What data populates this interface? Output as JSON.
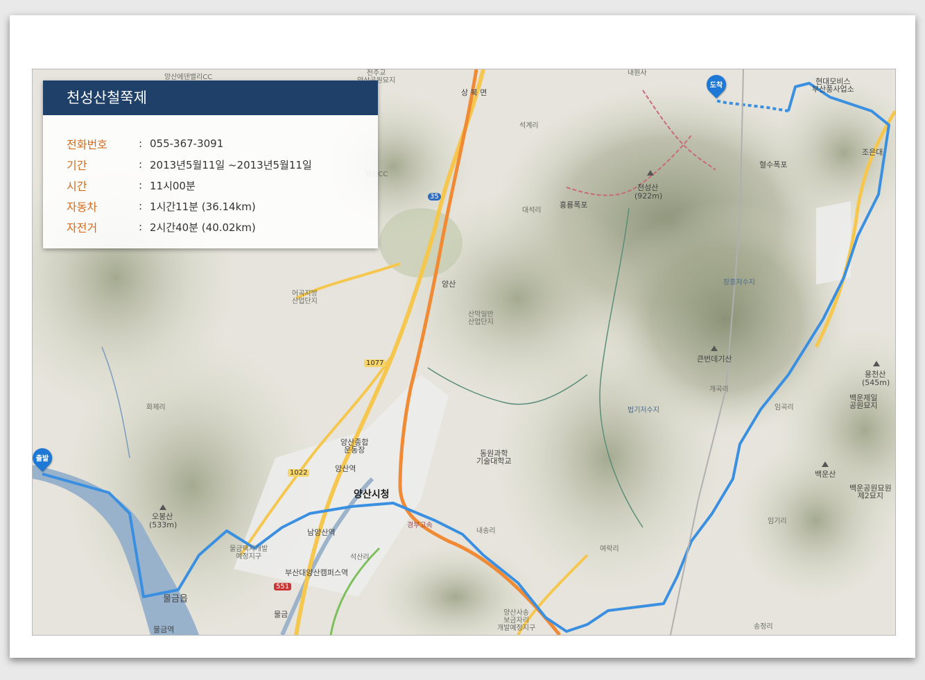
{
  "panel": {
    "title": "천성산철쭉제",
    "rows": [
      {
        "label": "전화번호",
        "value": "055-367-3091"
      },
      {
        "label": "기간",
        "value": "2013년5월11일 ~2013년5월11일"
      },
      {
        "label": "시간",
        "value": "11시00분"
      },
      {
        "label": "자동차",
        "value": "1시간11분 (36.14km)"
      },
      {
        "label": "자전거",
        "value": "2시간40분 (40.02km)"
      }
    ],
    "separator": ":"
  },
  "markers": {
    "start": "출발",
    "end": "도착"
  },
  "labels": {
    "city_hall": "양산시청",
    "cheonseongsan": "천성산",
    "cheonseongsan_h": "(922m)",
    "obongsan": "오봉산",
    "obongsan_h": "(533m)",
    "yongcheonsan": "용천산",
    "yongcheonsan_h": "(545m)",
    "baegunsan": "백운산",
    "keunbeondegisan": "큰번데기산",
    "heungnyong": "홍룡폭포",
    "hyeolsu": "혈수폭포",
    "yangsan_station": "양산역",
    "namyangsan_station": "남양산역",
    "pnu_station": "부산대양산캠퍼스역",
    "mulgeum_station": "물금역",
    "mulgeum_eup": "물금읍",
    "sports": "양산종합\n운동장",
    "dongwon": "동원과학\n기술대학교",
    "sanmak": "산막일반\n산업단지",
    "eogok": "어곡지방\n산업단지",
    "sangbuk": "상 북 면",
    "seokgye": "석계리",
    "daeseok": "대석리",
    "hwaje": "화제리",
    "naesong": "내송리",
    "yeorak": "여락리",
    "imgi": "임기리",
    "gaegok": "개곡리",
    "imgok": "임곡리",
    "songjeong": "송정리",
    "seoksan": "석산리",
    "beopgi": "법기저수지",
    "janghyeung": "장흥저수지",
    "hyundai": "현대모비스\n부산풍사업소",
    "baegun_cemetery": "백운공원묘원\n제2묘지",
    "baegun_jeil": "백운제일\n공원묘지",
    "gyeongbu": "경부고속",
    "ic_yangsan": "양산",
    "ic_mulgeum": "물금",
    "yangsan_cc": "양산CC",
    "route_35": "35",
    "route_1077": "1077",
    "route_1022": "1022",
    "route_551": "551",
    "new_town": "물금택지개발\n예정지구",
    "bogeum": "양산사송\n보금자리\n개발예정지구",
    "cheonju": "천주교\n양산공원묘지",
    "eden": "양산에덴밸리CC",
    "naewon": "내원사",
    "jowon": "조은대"
  },
  "colors": {
    "route": "#3a8fe0",
    "highway": "#f08a35",
    "road": "#f5c74e",
    "river": "#98b2cc",
    "panel_header": "#1f4068",
    "label_accent": "#d76a1c",
    "marker": "#1e78d6"
  }
}
